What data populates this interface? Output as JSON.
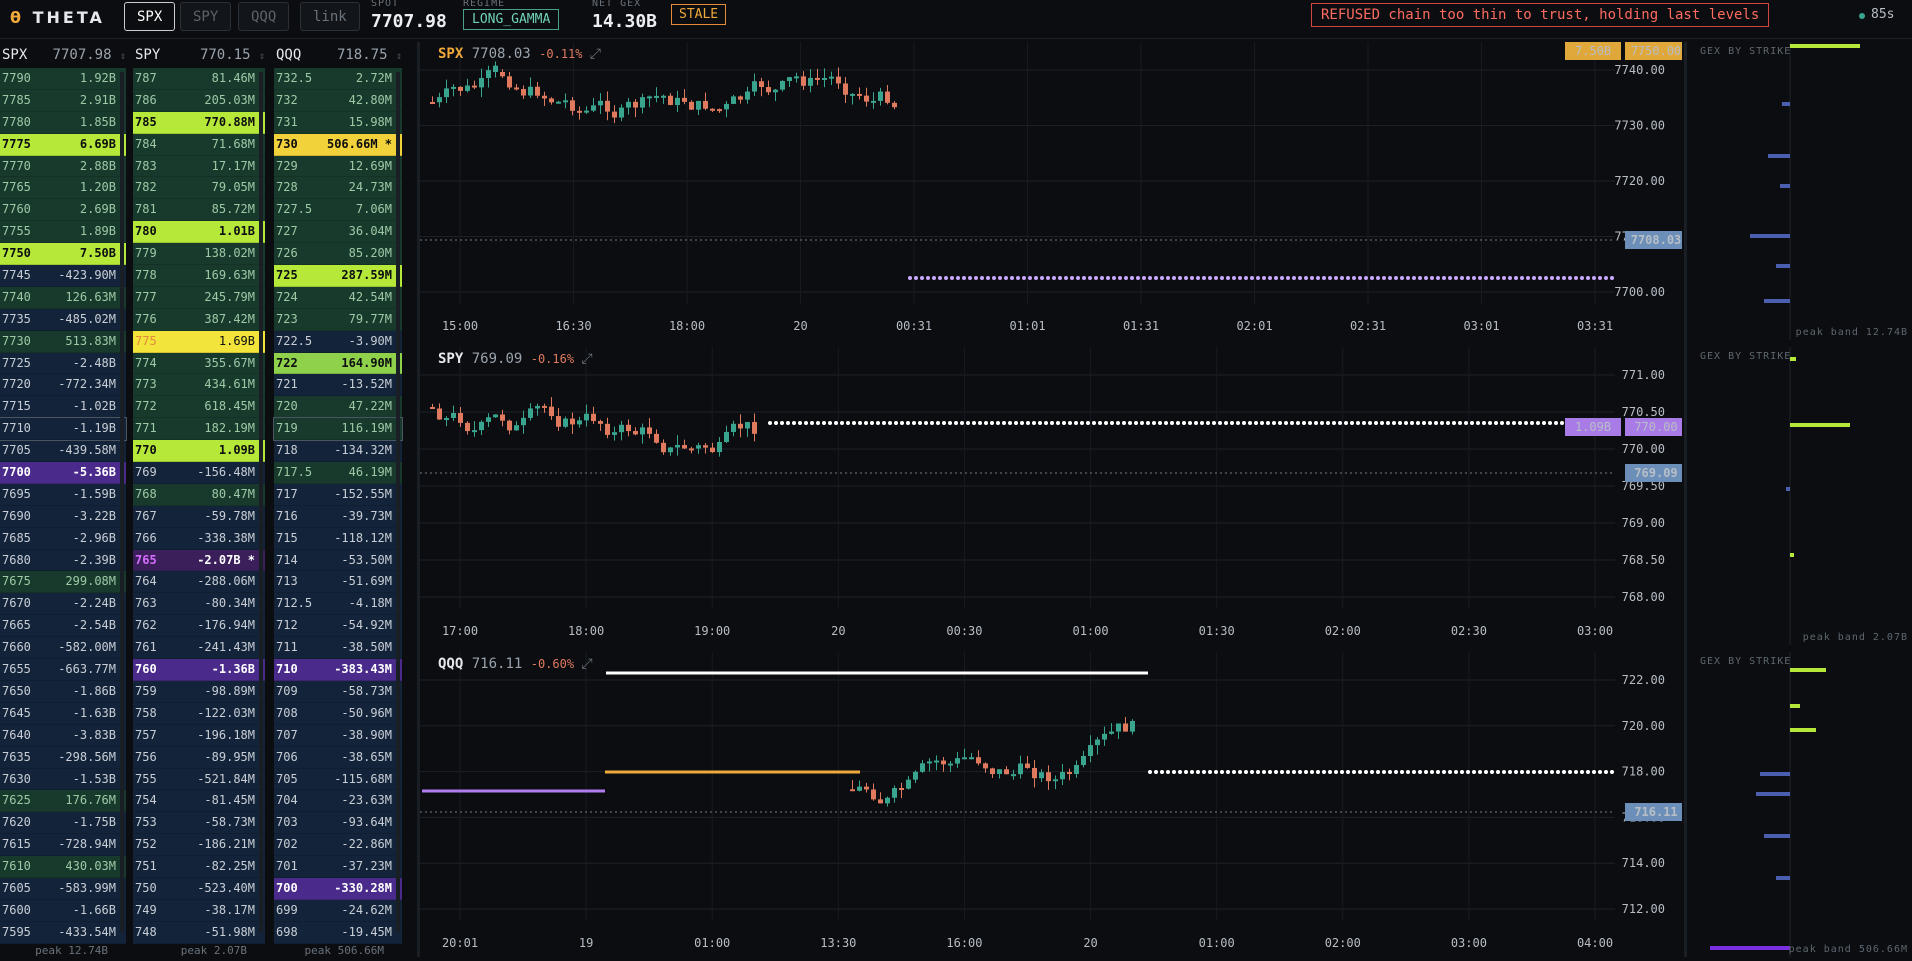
{
  "header": {
    "brand": "THETA",
    "tabs": [
      "SPX",
      "SPY",
      "QQQ"
    ],
    "link_label": "link",
    "spot_label": "SPOT",
    "spot_value": "7707.98",
    "regime_label": "REGIME",
    "regime_value": "LONG_GAMMA",
    "netgex_label": "NET GEX",
    "netgex_value": "14.30B",
    "stale_label": "STALE",
    "refused_message": "REFUSED chain too thin to trust, holding last levels",
    "timer": "85s"
  },
  "ladders": [
    {
      "symbol": "SPX",
      "price": "7707.98",
      "footer": "peak 12.74B",
      "rows": [
        [
          "7790",
          "1.92B",
          "pos"
        ],
        [
          "7785",
          "2.91B",
          "pos"
        ],
        [
          "7780",
          "1.85B",
          "pos"
        ],
        [
          "7775",
          "6.69B",
          "hi"
        ],
        [
          "7770",
          "2.88B",
          "pos"
        ],
        [
          "7765",
          "1.20B",
          "pos"
        ],
        [
          "7760",
          "2.69B",
          "pos"
        ],
        [
          "7755",
          "1.89B",
          "pos"
        ],
        [
          "7750",
          "7.50B",
          "hi"
        ],
        [
          "7745",
          "-423.90M",
          "neg"
        ],
        [
          "7740",
          "126.63M",
          "pos"
        ],
        [
          "7735",
          "-485.02M",
          "neg"
        ],
        [
          "7730",
          "513.83M",
          "pos"
        ],
        [
          "7725",
          "-2.48B",
          "neg"
        ],
        [
          "7720",
          "-772.34M",
          "neg"
        ],
        [
          "7715",
          "-1.02B",
          "neg"
        ],
        [
          "7710",
          "-1.19B",
          "negspot"
        ],
        [
          "7705",
          "-439.58M",
          "neg"
        ],
        [
          "7700",
          "-5.36B",
          "purple"
        ],
        [
          "7695",
          "-1.59B",
          "neg"
        ],
        [
          "7690",
          "-3.22B",
          "neg"
        ],
        [
          "7685",
          "-2.96B",
          "neg"
        ],
        [
          "7680",
          "-2.39B",
          "neg"
        ],
        [
          "7675",
          "299.08M",
          "pos"
        ],
        [
          "7670",
          "-2.24B",
          "neg"
        ],
        [
          "7665",
          "-2.54B",
          "neg"
        ],
        [
          "7660",
          "-582.00M",
          "neg"
        ],
        [
          "7655",
          "-663.77M",
          "neg"
        ],
        [
          "7650",
          "-1.86B",
          "neg"
        ],
        [
          "7645",
          "-1.63B",
          "neg"
        ],
        [
          "7640",
          "-3.83B",
          "neg"
        ],
        [
          "7635",
          "-298.56M",
          "neg"
        ],
        [
          "7630",
          "-1.53B",
          "neg"
        ],
        [
          "7625",
          "176.76M",
          "pos"
        ],
        [
          "7620",
          "-1.75B",
          "neg"
        ],
        [
          "7615",
          "-728.94M",
          "neg"
        ],
        [
          "7610",
          "430.03M",
          "pos"
        ],
        [
          "7605",
          "-583.99M",
          "neg"
        ],
        [
          "7600",
          "-1.66B",
          "neg"
        ],
        [
          "7595",
          "-433.54M",
          "neg"
        ]
      ]
    },
    {
      "symbol": "SPY",
      "price": "770.15",
      "footer": "peak 2.07B",
      "rows": [
        [
          "787",
          "81.46M",
          "pos"
        ],
        [
          "786",
          "205.03M",
          "pos"
        ],
        [
          "785",
          "770.88M",
          "hi"
        ],
        [
          "784",
          "71.68M",
          "pos"
        ],
        [
          "783",
          "17.17M",
          "pos"
        ],
        [
          "782",
          "79.05M",
          "pos"
        ],
        [
          "781",
          "85.72M",
          "pos"
        ],
        [
          "780",
          "1.01B",
          "hi"
        ],
        [
          "779",
          "138.02M",
          "pos"
        ],
        [
          "778",
          "169.63M",
          "pos"
        ],
        [
          "777",
          "245.79M",
          "pos"
        ],
        [
          "776",
          "387.42M",
          "pos"
        ],
        [
          "775",
          "1.69B",
          "yellow"
        ],
        [
          "774",
          "355.67M",
          "pos"
        ],
        [
          "773",
          "434.61M",
          "pos"
        ],
        [
          "772",
          "618.45M",
          "pos"
        ],
        [
          "771",
          "182.19M",
          "pos"
        ],
        [
          "770",
          "1.09B",
          "hi"
        ],
        [
          "769",
          "-156.48M",
          "neg"
        ],
        [
          "768",
          "80.47M",
          "pos"
        ],
        [
          "767",
          "-59.78M",
          "neg"
        ],
        [
          "766",
          "-338.38M",
          "neg"
        ],
        [
          "765",
          "-2.07B",
          "purplestar"
        ],
        [
          "764",
          "-288.06M",
          "neg"
        ],
        [
          "763",
          "-80.34M",
          "neg"
        ],
        [
          "762",
          "-176.94M",
          "neg"
        ],
        [
          "761",
          "-241.43M",
          "neg"
        ],
        [
          "760",
          "-1.36B",
          "purple"
        ],
        [
          "759",
          "-98.89M",
          "neg"
        ],
        [
          "758",
          "-122.03M",
          "neg"
        ],
        [
          "757",
          "-196.18M",
          "neg"
        ],
        [
          "756",
          "-89.95M",
          "neg"
        ],
        [
          "755",
          "-521.84M",
          "neg"
        ],
        [
          "754",
          "-81.45M",
          "neg"
        ],
        [
          "753",
          "-58.73M",
          "neg"
        ],
        [
          "752",
          "-186.21M",
          "neg"
        ],
        [
          "751",
          "-82.25M",
          "neg"
        ],
        [
          "750",
          "-523.40M",
          "neg"
        ],
        [
          "749",
          "-38.17M",
          "neg"
        ],
        [
          "748",
          "-51.98M",
          "neg"
        ]
      ]
    },
    {
      "symbol": "QQQ",
      "price": "718.75",
      "footer": "peak 506.66M",
      "rows": [
        [
          "732.5",
          "2.72M",
          "pos"
        ],
        [
          "732",
          "42.80M",
          "pos"
        ],
        [
          "731",
          "15.98M",
          "pos"
        ],
        [
          "730",
          "506.66M",
          "goldstar"
        ],
        [
          "729",
          "12.69M",
          "pos"
        ],
        [
          "728",
          "24.73M",
          "pos"
        ],
        [
          "727.5",
          "7.06M",
          "pos"
        ],
        [
          "727",
          "36.04M",
          "pos"
        ],
        [
          "726",
          "85.20M",
          "pos"
        ],
        [
          "725",
          "287.59M",
          "hi"
        ],
        [
          "724",
          "42.54M",
          "pos"
        ],
        [
          "723",
          "79.77M",
          "pos"
        ],
        [
          "722.5",
          "-3.90M",
          "neg"
        ],
        [
          "722",
          "164.90M",
          "hi2"
        ],
        [
          "721",
          "-13.52M",
          "neg"
        ],
        [
          "720",
          "47.22M",
          "pos"
        ],
        [
          "719",
          "116.19M",
          "posspot"
        ],
        [
          "718",
          "-134.32M",
          "neg"
        ],
        [
          "717.5",
          "46.19M",
          "pos"
        ],
        [
          "717",
          "-152.55M",
          "neg"
        ],
        [
          "716",
          "-39.73M",
          "neg"
        ],
        [
          "715",
          "-118.12M",
          "neg"
        ],
        [
          "714",
          "-53.50M",
          "neg"
        ],
        [
          "713",
          "-51.69M",
          "neg"
        ],
        [
          "712.5",
          "-4.18M",
          "neg"
        ],
        [
          "712",
          "-54.92M",
          "neg"
        ],
        [
          "711",
          "-38.50M",
          "neg"
        ],
        [
          "710",
          "-383.43M",
          "purple"
        ],
        [
          "709",
          "-58.73M",
          "neg"
        ],
        [
          "708",
          "-50.96M",
          "neg"
        ],
        [
          "707",
          "-38.90M",
          "neg"
        ],
        [
          "706",
          "-38.65M",
          "neg"
        ],
        [
          "705",
          "-115.68M",
          "neg"
        ],
        [
          "704",
          "-23.63M",
          "neg"
        ],
        [
          "703",
          "-93.64M",
          "neg"
        ],
        [
          "702",
          "-22.86M",
          "neg"
        ],
        [
          "701",
          "-37.23M",
          "neg"
        ],
        [
          "700",
          "-330.28M",
          "purple"
        ],
        [
          "699",
          "-24.62M",
          "neg"
        ],
        [
          "698",
          "-19.45M",
          "neg"
        ]
      ]
    }
  ],
  "charts": [
    {
      "symbol": "SPX",
      "price": "7708.03",
      "change": "-0.11%",
      "yticks": [
        "7740.00",
        "7730.00",
        "7720.00",
        "7710.00",
        "7700.00"
      ],
      "xticks": [
        "15:00",
        "16:30",
        "18:00",
        "20",
        "00:31",
        "01:01",
        "01:31",
        "02:01",
        "02:31",
        "03:01",
        "03:31"
      ],
      "tag_gex": "7.50B",
      "tag_level": "7750.00",
      "tag_price": "7708.03",
      "gex_label": "GEX BY STRIKE",
      "peak_label": "peak band 12.74B"
    },
    {
      "symbol": "SPY",
      "price": "769.09",
      "change": "-0.16%",
      "yticks": [
        "771.00",
        "770.50",
        "770.00",
        "769.50",
        "769.00",
        "768.50",
        "768.00"
      ],
      "xticks": [
        "17:00",
        "18:00",
        "19:00",
        "20",
        "00:30",
        "01:00",
        "01:30",
        "02:00",
        "02:30",
        "03:00"
      ],
      "tag_gex": "1.09B",
      "tag_level": "770.00",
      "tag_price": "769.09",
      "gex_label": "GEX BY STRIKE",
      "peak_label": "peak band 2.07B"
    },
    {
      "symbol": "QQQ",
      "price": "716.11",
      "change": "-0.60%",
      "yticks": [
        "722.00",
        "720.00",
        "718.00",
        "716.00",
        "714.00",
        "712.00"
      ],
      "xticks": [
        "20:01",
        "19",
        "01:00",
        "13:30",
        "16:00",
        "20",
        "01:00",
        "02:00",
        "03:00",
        "04:00"
      ],
      "tag_price": "716.11",
      "gex_label": "GEX BY STRIKE",
      "peak_label": "peak band 506.66M"
    }
  ],
  "colors": {
    "up": "#3aa58f",
    "down": "#e07a5f",
    "accent": "#f2a93b",
    "purple": "#b07cf0",
    "lime": "#b6e83a"
  }
}
